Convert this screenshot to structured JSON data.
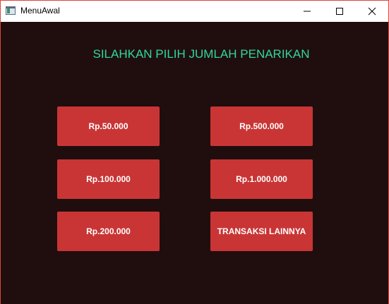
{
  "window": {
    "title": "MenuAwal",
    "icon": "java-window-icon",
    "controls": {
      "minimize_icon": "minimize-icon",
      "maximize_icon": "maximize-icon",
      "close_icon": "close-icon"
    }
  },
  "colors": {
    "background": "#200e0f",
    "heading": "#2fd89d",
    "button": "#c93535",
    "button_text": "#ffffff",
    "window_border": "#e0453b"
  },
  "main": {
    "heading": "SILAHKAN PILIH JUMLAH PENARIKAN",
    "buttons": {
      "b50": "Rp.50.000",
      "b100": "Rp.100.000",
      "b200": "Rp.200.000",
      "b500": "Rp.500.000",
      "b1000": "Rp.1.000.000",
      "other": "TRANSAKSI LAINNYA"
    }
  }
}
